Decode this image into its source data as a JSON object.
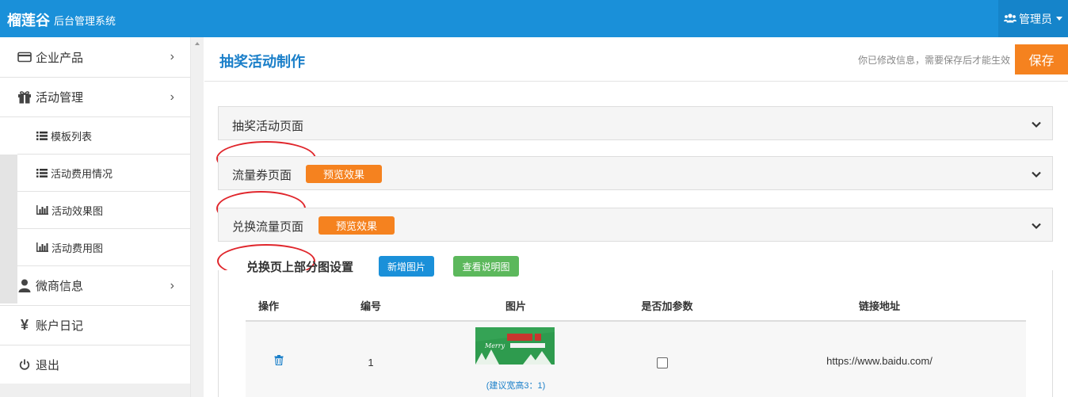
{
  "topbar": {
    "brand": "榴莲谷",
    "subtitle": "后台管理系统",
    "user_label": "管理员"
  },
  "sidebar": {
    "items": [
      {
        "label": "企业产品",
        "icon": "credit-card-icon"
      },
      {
        "label": "活动管理",
        "icon": "gift-icon"
      },
      {
        "label": "微商信息",
        "icon": "user-icon"
      },
      {
        "label": "账户日记",
        "icon": "yen-icon"
      },
      {
        "label": "退出",
        "icon": "power-icon"
      }
    ],
    "sub_items": [
      {
        "label": "模板列表",
        "icon": "list-icon"
      },
      {
        "label": "活动费用情况",
        "icon": "list-icon"
      },
      {
        "label": "活动效果图",
        "icon": "bar-chart-icon"
      },
      {
        "label": "活动费用图",
        "icon": "bar-chart-icon"
      }
    ]
  },
  "header": {
    "title": "抽奖活动制作",
    "hint": "你已修改信息，需要保存后才能生效",
    "save_label": "保存"
  },
  "panels": [
    {
      "title": "抽奖活动页面"
    },
    {
      "title": "流量券页面",
      "preview_label": "预览效果"
    },
    {
      "title": "兑换流量页面",
      "preview_label": "预览效果"
    }
  ],
  "image_section": {
    "title": "兑换页上部分图设置",
    "add_label": "新增图片",
    "guide_label": "查看说明图",
    "columns": [
      "操作",
      "编号",
      "图片",
      "是否加参数",
      "链接地址"
    ],
    "rows": [
      {
        "number": "1",
        "note": "(建议宽高3：1)",
        "link": "https://www.baidu.com/",
        "has_param": false
      }
    ]
  },
  "colors": {
    "topbar": "#1a90d9",
    "accent_orange": "#f5821f",
    "title_blue": "#1a7fc9",
    "green": "#5cb85c",
    "highlight_red": "#e0262c"
  }
}
